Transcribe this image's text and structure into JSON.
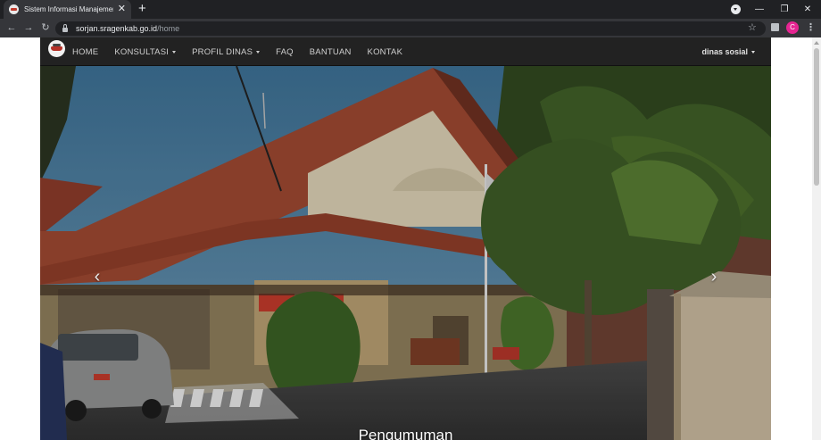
{
  "browser": {
    "tab_title": "Sistem Informasi Manajemen Ko",
    "tab_close": "✕",
    "new_tab": "+",
    "back": "←",
    "forward": "→",
    "reload": "↻",
    "url_domain": "sorjan.sragenkab.go.id",
    "url_path": "/home",
    "bookmark_star": "☆",
    "profile_initial": "C",
    "menu": "⋮",
    "minimize": "—",
    "restore": "❐",
    "close": "✕"
  },
  "nav": {
    "items": [
      {
        "label": "HOME",
        "dropdown": false
      },
      {
        "label": "KONSULTASI",
        "dropdown": true
      },
      {
        "label": "PROFIL DINAS",
        "dropdown": true
      },
      {
        "label": "FAQ",
        "dropdown": false
      },
      {
        "label": "BANTUAN",
        "dropdown": false
      },
      {
        "label": "KONTAK",
        "dropdown": false
      }
    ],
    "user_label": "dinas sosial"
  },
  "carousel": {
    "prev_label": "‹",
    "next_label": "›",
    "caption": "Pengumuman"
  },
  "colors": {
    "navbar_bg": "#222222",
    "chrome_dark": "#202124",
    "profile_accent": "#e52592"
  }
}
